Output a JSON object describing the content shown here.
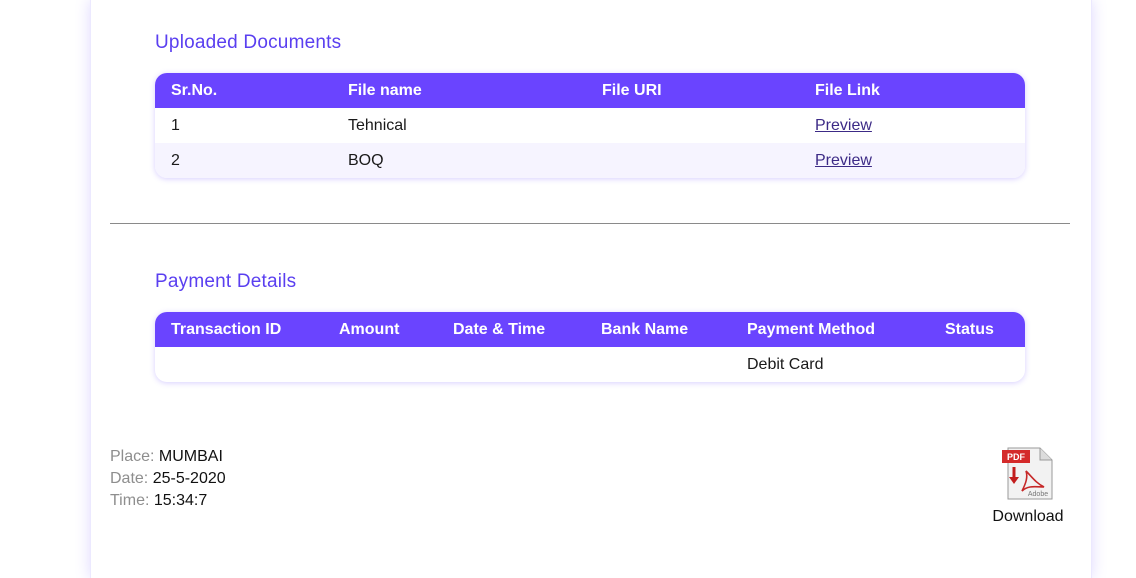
{
  "docs": {
    "title": "Uploaded Documents",
    "headers": [
      "Sr.No.",
      "File name",
      "File URI",
      "File Link"
    ],
    "rows": [
      {
        "sr": "1",
        "name": "Tehnical",
        "uri": "",
        "link": "Preview"
      },
      {
        "sr": "2",
        "name": "BOQ",
        "uri": "",
        "link": "Preview"
      }
    ]
  },
  "payment": {
    "title": "Payment Details",
    "headers": [
      "Transaction ID",
      "Amount",
      "Date & Time",
      "Bank Name",
      "Payment Method",
      "Status"
    ],
    "rows": [
      {
        "txn": "",
        "amount": "",
        "datetime": "",
        "bank": "",
        "method": "Debit Card",
        "status": ""
      }
    ]
  },
  "meta": {
    "place_label": "Place:",
    "place": "MUMBAI",
    "date_label": "Date:",
    "date": "25-5-2020",
    "time_label": "Time:",
    "time": "15:34:7"
  },
  "download": {
    "label": "Download",
    "icon": "pdf-file-icon",
    "icon_text": "PDF",
    "icon_brand": "Adobe"
  },
  "colors": {
    "accent": "#6a44ff",
    "title": "#5a3ff0",
    "pdf_red": "#d42a2a"
  }
}
